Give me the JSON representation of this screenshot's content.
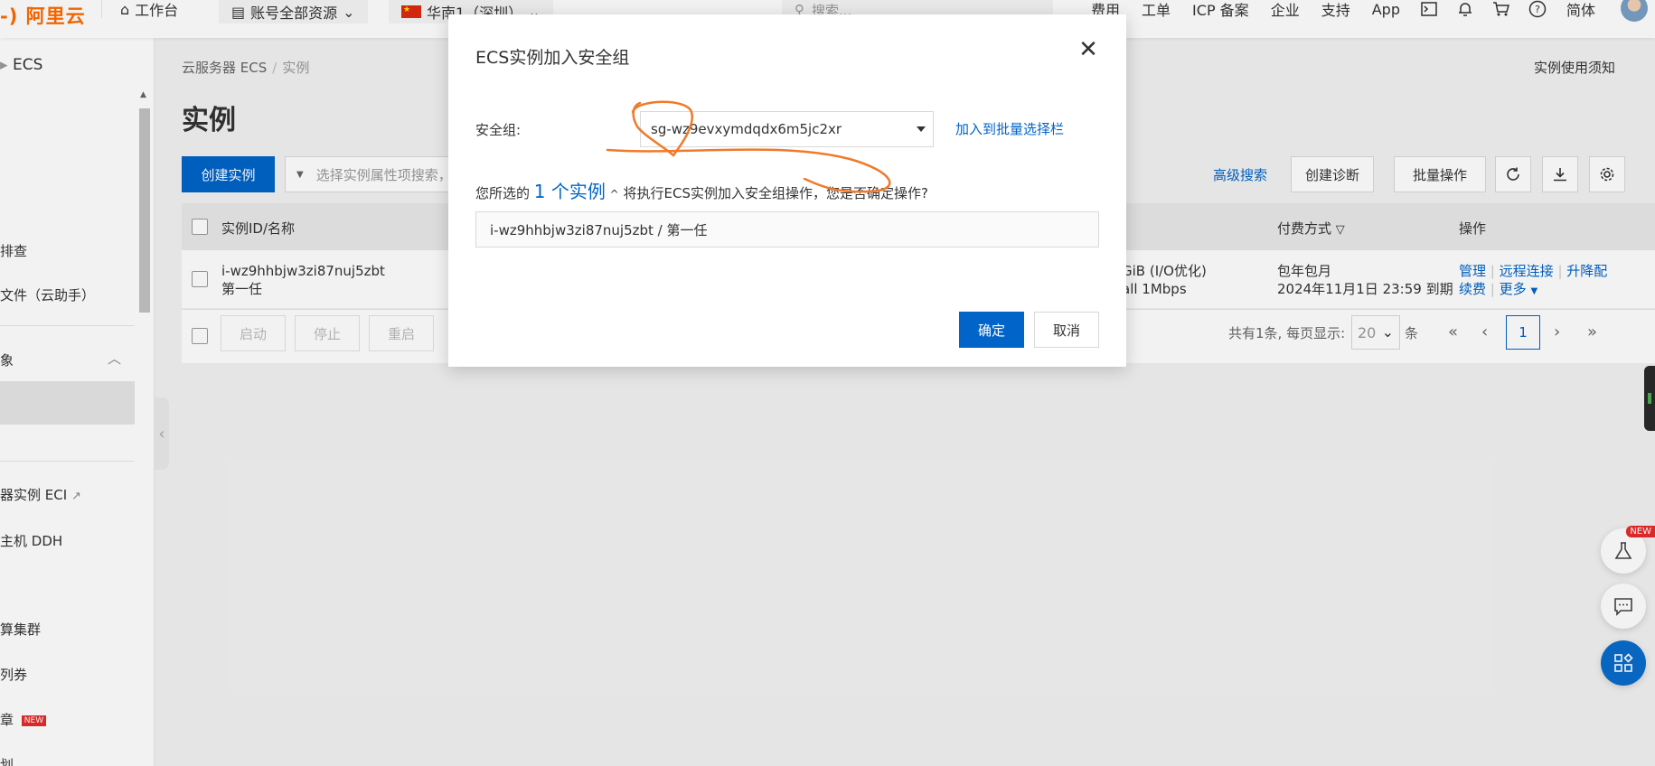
{
  "topbar": {
    "logo": "-) 阿里云",
    "workbench": "工作台",
    "account_resources": "账号全部资源",
    "region": "华南1（深圳）",
    "search_placeholder": "搜索...",
    "links": [
      "费用",
      "工单",
      "ICP 备案",
      "企业",
      "支持",
      "App"
    ],
    "language": "简体"
  },
  "sidebar": {
    "title": "ECS",
    "items": [
      "排查",
      "文件（云助手）",
      "象",
      "器实例 ECI",
      "主机 DDH",
      "算集群",
      "列券",
      "章",
      "划"
    ],
    "new_badge": "NEW"
  },
  "main": {
    "breadcrumb": [
      "云服务器 ECS",
      "实例"
    ],
    "breadcrumb_sep": "/",
    "page_title": "实例",
    "notice_link": "实例使用须知",
    "create_button": "创建实例",
    "search_placeholder": "选择实例属性项搜索，",
    "advanced_search": "高级搜索",
    "create_diagnosis": "创建诊断",
    "batch_operations": "批量操作",
    "table": {
      "headers": {
        "id_name": "实例ID/名称",
        "billing": "付费方式",
        "actions": "操作"
      },
      "rows": [
        {
          "id": "i-wz9hhbjw3zi87nuj5zbt",
          "name": "第一任",
          "spec": "GiB   (I/O优化)",
          "bandwidth": "all   1Mbps",
          "billing_type": "包年包月",
          "expire": "2024年11月1日 23:59 到期",
          "actions": [
            "管理",
            "远程连接",
            "升降配",
            "续费",
            "更多"
          ]
        }
      ]
    },
    "footer": {
      "start": "启动",
      "stop": "停止",
      "restart": "重启",
      "total_text": "共有1条, 每页显示:",
      "page_size": "20",
      "unit": "条",
      "current_page": "1"
    }
  },
  "dialog": {
    "title": "ECS实例加入安全组",
    "sg_label": "安全组:",
    "sg_value": "sg-wz9evxymdqdx6m5jc2xr",
    "add_to_batch": "加入到批量选择栏",
    "confirm_prefix": "您所选的",
    "confirm_count": "1 个实例",
    "confirm_suffix": "将执行ECS实例加入安全组操作，您是否确定操作?",
    "instance_summary": "i-wz9hhbjw3zi87nuj5zbt / 第一任",
    "ok": "确定",
    "cancel": "取消"
  },
  "floating": {
    "new_label": "NEW"
  },
  "colors": {
    "brand_orange": "#ff6a00",
    "primary_blue": "#0064c8",
    "annotation_orange": "#f07a2a"
  }
}
